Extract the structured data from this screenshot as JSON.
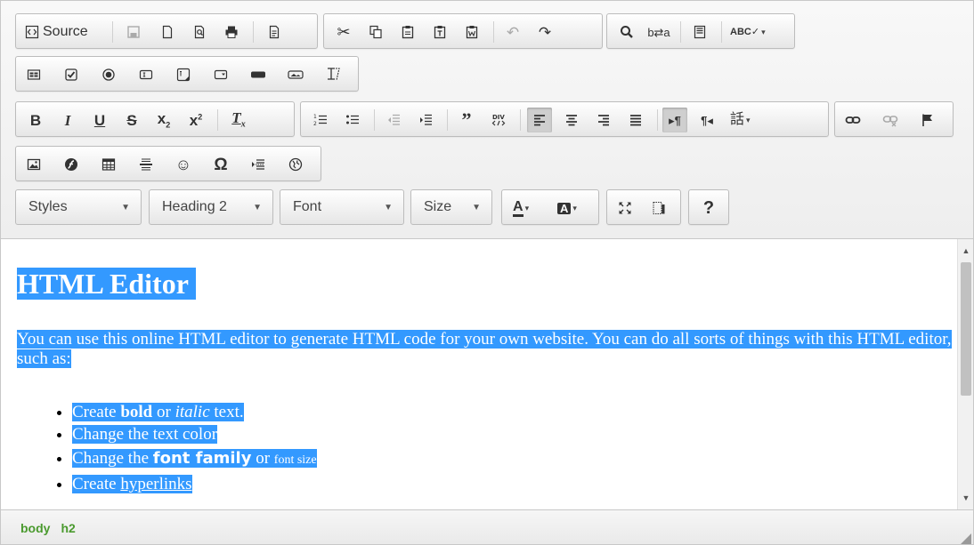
{
  "toolbar": {
    "source_label": "Source",
    "styles": "Styles",
    "format": "Heading 2",
    "font": "Font",
    "size": "Size",
    "help": "?"
  },
  "icons": {
    "row1": [
      "source-icon",
      "save-icon",
      "new-page-icon",
      "preview-icon",
      "print-icon",
      "templates-icon",
      "cut-icon",
      "copy-icon",
      "paste-icon",
      "paste-text-icon",
      "paste-word-icon",
      "undo-icon",
      "redo-icon",
      "find-icon",
      "replace-icon",
      "select-all-icon",
      "spellcheck-icon"
    ],
    "row2": [
      "form-icon",
      "checkbox-icon",
      "radio-icon",
      "text-field-icon",
      "textarea-icon",
      "select-icon",
      "button-icon",
      "image-button-icon",
      "hidden-field-icon"
    ],
    "row3": [
      "bold-icon",
      "italic-icon",
      "underline-icon",
      "strike-icon",
      "subscript-icon",
      "superscript-icon",
      "remove-format-icon",
      "numbered-list-icon",
      "bulleted-list-icon",
      "outdent-icon",
      "indent-icon",
      "blockquote-icon",
      "div-icon",
      "align-left-icon",
      "align-center-icon",
      "align-right-icon",
      "justify-icon",
      "ltr-icon",
      "rtl-icon",
      "language-icon",
      "link-icon",
      "unlink-icon",
      "anchor-icon"
    ],
    "row4": [
      "image-icon",
      "flash-icon",
      "table-icon",
      "horizontal-rule-icon",
      "smiley-icon",
      "special-char-icon",
      "page-break-icon",
      "iframe-icon"
    ],
    "row5": [
      "text-color-icon",
      "bg-color-icon",
      "maximize-icon",
      "show-blocks-icon",
      "help-icon"
    ]
  },
  "content": {
    "heading": "HTML Editor",
    "paragraph": "You can use this online HTML editor to generate HTML code for your own website. You can do all sorts of things with this HTML editor, such as:",
    "list": {
      "item1_a": "Create ",
      "item1_b": "bold",
      "item1_c": " or ",
      "item1_d": "italic",
      "item1_e": " text.",
      "item2": "Change the text color",
      "item3_a": "Change the ",
      "item3_b": "font family",
      "item3_c": " or ",
      "item3_d": "font size",
      "item4_a": "Create ",
      "item4_b": "hyperlinks"
    }
  },
  "status": {
    "path1": "body",
    "path2": "h2"
  },
  "colors": {
    "selection": "#3399ff",
    "status_path": "#4a9a2e",
    "toolbar_bg": "#f0f0f0"
  }
}
